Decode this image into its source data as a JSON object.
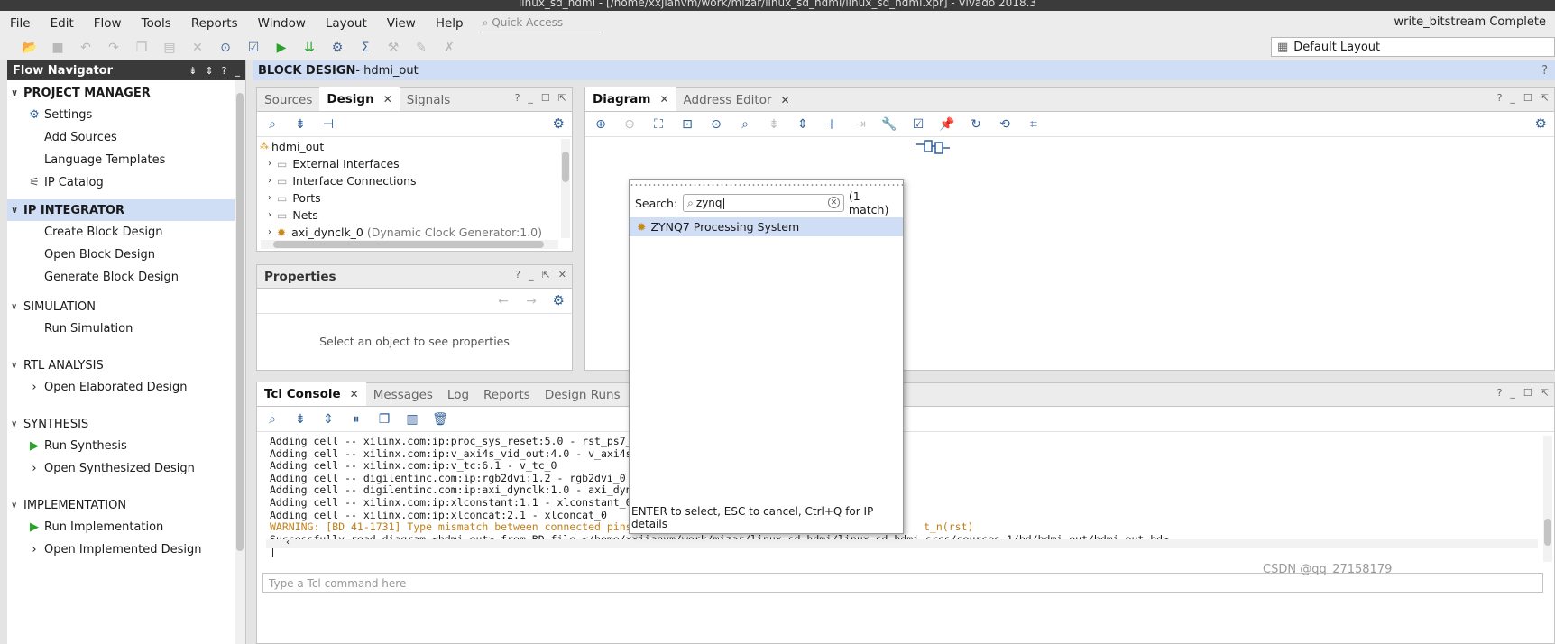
{
  "window": {
    "title": "linux_sd_hdmi - [/home/xxjianvm/work/mizar/linux_sd_hdmi/linux_sd_hdmi.xpr] - Vivado 2018.3",
    "status": "write_bitstream Complete"
  },
  "menu": [
    "File",
    "Edit",
    "Flow",
    "Tools",
    "Reports",
    "Window",
    "Layout",
    "View",
    "Help"
  ],
  "quick_access": {
    "placeholder": "Quick Access"
  },
  "layout_select": {
    "value": "Default Layout"
  },
  "flow_navigator": {
    "title": "Flow Navigator",
    "sections": [
      {
        "label": "PROJECT MANAGER",
        "items": [
          "Settings",
          "Add Sources",
          "Language Templates",
          "IP Catalog"
        ]
      },
      {
        "label": "IP INTEGRATOR",
        "items": [
          "Create Block Design",
          "Open Block Design",
          "Generate Block Design"
        ]
      },
      {
        "label": "SIMULATION",
        "items": [
          "Run Simulation"
        ]
      },
      {
        "label": "RTL ANALYSIS",
        "items": [
          "Open Elaborated Design"
        ]
      },
      {
        "label": "SYNTHESIS",
        "items": [
          "Run Synthesis",
          "Open Synthesized Design"
        ]
      },
      {
        "label": "IMPLEMENTATION",
        "items": [
          "Run Implementation",
          "Open Implemented Design"
        ]
      }
    ]
  },
  "block_design": {
    "label": "BLOCK DESIGN",
    "name": " - hdmi_out"
  },
  "sources_panel": {
    "tabs": [
      "Sources",
      "Design",
      "Signals"
    ],
    "tree": {
      "root": "hdmi_out",
      "items": [
        "External Interfaces",
        "Interface Connections",
        "Ports",
        "Nets"
      ],
      "cell": "axi_dynclk_0",
      "cell_detail": "(Dynamic Clock Generator:1.0)"
    }
  },
  "properties_panel": {
    "title": "Properties",
    "empty": "Select an object to see properties"
  },
  "diagram_panel": {
    "tabs": [
      "Diagram",
      "Address Editor"
    ]
  },
  "console_panel": {
    "tabs": [
      "Tcl Console",
      "Messages",
      "Log",
      "Reports",
      "Design Runs"
    ],
    "lines": [
      "Adding cell -- xilinx.com:ip:proc_sys_reset:5.0 - rst_ps7_0_",
      "Adding cell -- xilinx.com:ip:v_axi4s_vid_out:4.0 - v_axi4s_v",
      "Adding cell -- xilinx.com:ip:v_tc:6.1 - v_tc_0",
      "Adding cell -- digilentinc.com:ip:rgb2dvi:1.2 - rgb2dvi_0",
      "Adding cell -- digilentinc.com:ip:axi_dynclk:1.0 - axi_dyncl",
      "Adding cell -- xilinx.com:ip:xlconstant:1.1 - xlconstant_0",
      "Adding cell -- xilinx.com:ip:xlconcat:2.1 - xlconcat_0"
    ],
    "warning": "WARNING: [BD 41-1731] Type mismatch between connected pins:",
    "warning_tail": "t_n(rst)",
    "success": "Successfully read diagram <hdmi_out> from BD file </home/xxjianvm/work/mizar/linux_sd_hdmi/linux_sd_hdmi.srcs/sources_1/bd/hdmi_out/hdmi_out.bd>",
    "input_placeholder": "Type a Tcl command here"
  },
  "ip_search": {
    "label": "Search:",
    "query": "zynq",
    "count": "(1 match)",
    "results": [
      "ZYNQ7 Processing System"
    ],
    "hint": "ENTER to select, ESC to cancel, Ctrl+Q for IP details"
  },
  "watermark": "CSDN @qq_27158179"
}
